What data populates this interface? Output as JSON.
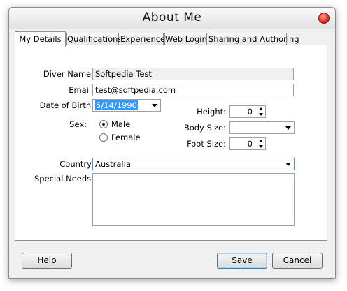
{
  "window": {
    "title": "About Me"
  },
  "tabs": [
    {
      "label": "My Details",
      "active": true
    },
    {
      "label": "Qualifications",
      "active": false
    },
    {
      "label": "Experience",
      "active": false
    },
    {
      "label": "Web Login",
      "active": false
    },
    {
      "label": "Sharing and Authoring",
      "active": false
    }
  ],
  "form": {
    "diver_name": {
      "label": "Diver Name:",
      "value": "Softpedia Test"
    },
    "email": {
      "label": "Email:",
      "value": "test@softpedia.com"
    },
    "dob": {
      "label": "Date of Birth:",
      "value": "5/14/1990"
    },
    "sex": {
      "label": "Sex:",
      "options": [
        "Male",
        "Female"
      ],
      "selected": "Male"
    },
    "height": {
      "label": "Height:",
      "value": "0"
    },
    "body_size": {
      "label": "Body Size:",
      "value": ""
    },
    "foot_size": {
      "label": "Foot Size:",
      "value": "0"
    },
    "country": {
      "label": "Country:",
      "value": "Australia"
    },
    "special_needs": {
      "label": "Special Needs:",
      "value": ""
    }
  },
  "buttons": {
    "help": "Help",
    "save": "Save",
    "cancel": "Cancel"
  },
  "icons": {
    "close": "close-icon",
    "dropdown": "chevron-down-icon",
    "spin": "spinner-arrows-icon"
  }
}
